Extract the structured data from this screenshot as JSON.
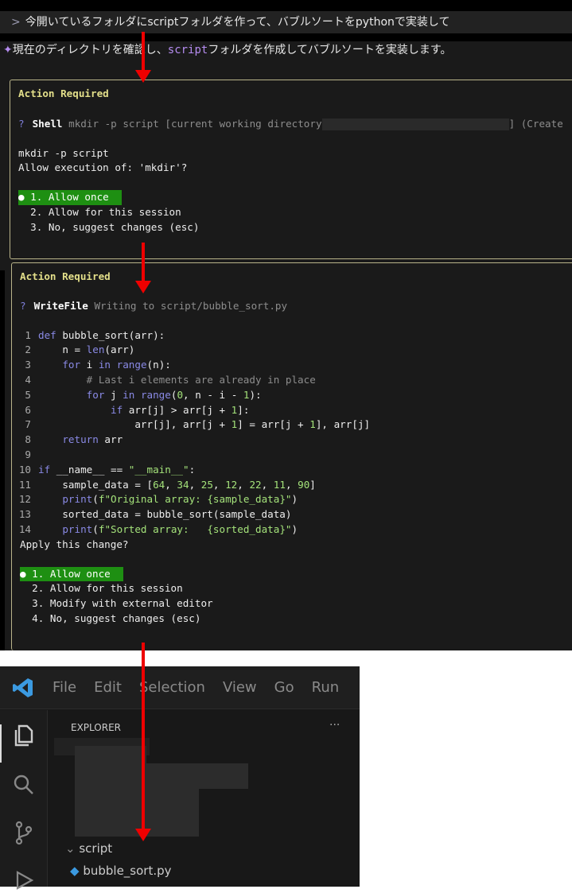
{
  "prompt": {
    "chevron": ">",
    "text": "今開いているフォルダにscriptフォルダを作って、バブルソートをpythonで実装して"
  },
  "response": {
    "icon": "✦",
    "before": "現在のディレクトリを確認し、",
    "keyword": "script",
    "after": "フォルダを作成してバブルソートを実装します。"
  },
  "shell_action": {
    "title": "Action Required",
    "q": "?",
    "tool": "Shell",
    "desc": "mkdir -p script [current working directory",
    "desc_end": "] (Create",
    "command": "mkdir -p script",
    "question": "Allow execution of: 'mkdir'?",
    "options": [
      "● 1. Allow once",
      "  2. Allow for this session",
      "  3. No, suggest changes (esc)"
    ],
    "selected": 0
  },
  "write_action": {
    "title": "Action Required",
    "q": "?",
    "tool": "WriteFile",
    "desc": "Writing to script/bubble_sort.py",
    "code": [
      "def bubble_sort(arr):",
      "    n = len(arr)",
      "    for i in range(n):",
      "        # Last i elements are already in place",
      "        for j in range(0, n - i - 1):",
      "            if arr[j] > arr[j + 1]:",
      "                arr[j], arr[j + 1] = arr[j + 1], arr[j]",
      "    return arr",
      "",
      "if __name__ == \"__main__\":",
      "    sample_data = [64, 34, 25, 12, 22, 11, 90]",
      "    print(f\"Original array: {sample_data}\")",
      "    sorted_data = bubble_sort(sample_data)",
      "    print(f\"Sorted array:   {sorted_data}\")"
    ],
    "question": "Apply this change?",
    "options": [
      "● 1. Allow once",
      "  2. Allow for this session",
      "  3. Modify with external editor",
      "  4. No, suggest changes (esc)"
    ],
    "selected": 0
  },
  "vscode": {
    "menu": [
      "File",
      "Edit",
      "Selection",
      "View",
      "Go",
      "Run"
    ],
    "explorer_title": "EXPLORER",
    "more": "···",
    "folder": "script",
    "file": "bubble_sort.py",
    "accent": "#3b9ae1"
  },
  "colors": {
    "selected_option": "#1e8f12",
    "annotation_arrow": "#e00000",
    "border": "#b9b48a"
  }
}
